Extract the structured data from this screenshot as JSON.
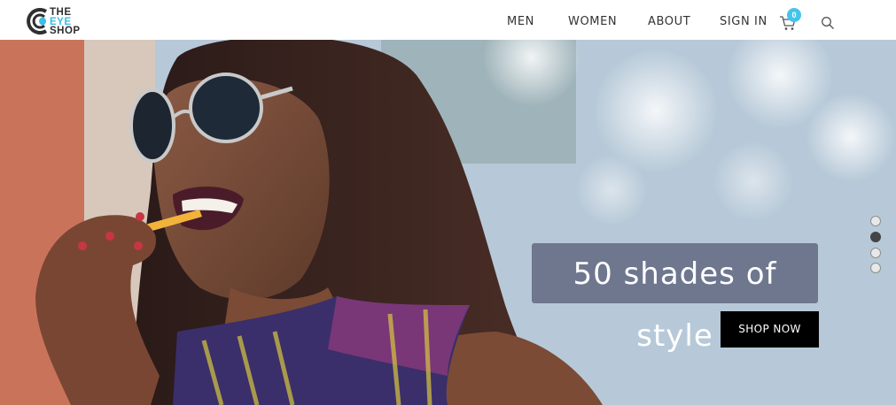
{
  "logo": {
    "line1": "THE",
    "line2": "EYE",
    "line3": "SHOP"
  },
  "nav": {
    "men": "MEN",
    "women": "WOMEN",
    "about": "ABOUT",
    "sign_in": "SIGN IN"
  },
  "cart": {
    "count": "0"
  },
  "icons": {
    "cart": "cart-icon",
    "search": "search-icon",
    "logo": "eye-logo-icon"
  },
  "hero": {
    "headline": "50 shades of style",
    "cta": "SHOP NOW",
    "slides": 4,
    "active_slide": 2
  },
  "colors": {
    "accent": "#45c4ea",
    "button": "#000000",
    "headline_bg": "#5a6078"
  }
}
